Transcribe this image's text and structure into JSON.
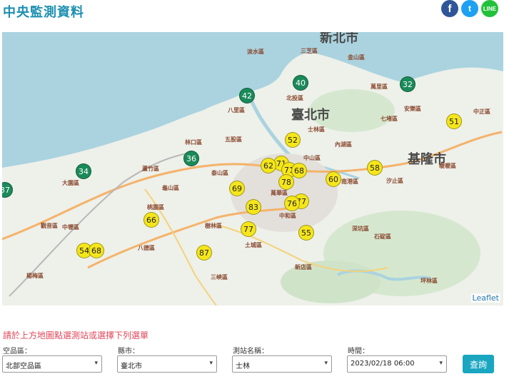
{
  "header": {
    "title": "中央監測資料",
    "social": {
      "facebook": "f",
      "twitter": "t",
      "line": "LINE"
    }
  },
  "map": {
    "regions": {
      "new_taipei": "新北市",
      "taipei": "臺北市",
      "keelung": "基隆市"
    },
    "districts": [
      "淡水區",
      "三芝區",
      "金山區",
      "萬里區",
      "八里區",
      "北投區",
      "士林區",
      "七堵區",
      "中正區",
      "五股區",
      "林口區",
      "內湖區",
      "暖暖區",
      "中山區",
      "汐止區",
      "泰山區",
      "蘆竹區",
      "龜山區",
      "桃園區",
      "樹林區",
      "土城區",
      "中和區",
      "南港區",
      "深坑區",
      "石碇區",
      "大園區",
      "中壢區",
      "八德區",
      "三峽區",
      "新店區",
      "坪林區",
      "楊梅區",
      "觀音區",
      "萬華區",
      "安樂區"
    ],
    "attribution": "Leaflet",
    "markers": [
      {
        "value": "40",
        "level": "good"
      },
      {
        "value": "42",
        "level": "good"
      },
      {
        "value": "32",
        "level": "good"
      },
      {
        "value": "52",
        "level": "moderate"
      },
      {
        "value": "51",
        "level": "moderate"
      },
      {
        "value": "36",
        "level": "good"
      },
      {
        "value": "34",
        "level": "good"
      },
      {
        "value": "62",
        "level": "moderate"
      },
      {
        "value": "71",
        "level": "moderate"
      },
      {
        "value": "68",
        "level": "moderate"
      },
      {
        "value": "58",
        "level": "moderate"
      },
      {
        "value": "60",
        "level": "moderate"
      },
      {
        "value": "78",
        "level": "moderate"
      },
      {
        "value": "69",
        "level": "moderate"
      },
      {
        "value": "77",
        "level": "moderate"
      },
      {
        "value": "76",
        "level": "moderate"
      },
      {
        "value": "83",
        "level": "moderate"
      },
      {
        "value": "37",
        "level": "good"
      },
      {
        "value": "66",
        "level": "moderate"
      },
      {
        "value": "77",
        "level": "moderate"
      },
      {
        "value": "55",
        "level": "moderate"
      },
      {
        "value": "54",
        "level": "moderate"
      },
      {
        "value": "68",
        "level": "moderate"
      },
      {
        "value": "87",
        "level": "moderate"
      }
    ]
  },
  "form": {
    "hint": "請於上方地圖點選測站或選擇下列選單",
    "area_label": "空品區：",
    "area_value": "北部空品區",
    "county_label": "縣市：",
    "county_value": "臺北市",
    "station_label": "測站名稱：",
    "station_value": "士林",
    "time_label": "時間：",
    "time_value": "2023/02/18 06:00",
    "query_button": "查詢"
  },
  "colors": {
    "good": "#1b8a5a",
    "moderate": "#f5e61b",
    "title": "#1a8fb0",
    "hint": "#e0485a",
    "button": "#1aa6c0"
  }
}
